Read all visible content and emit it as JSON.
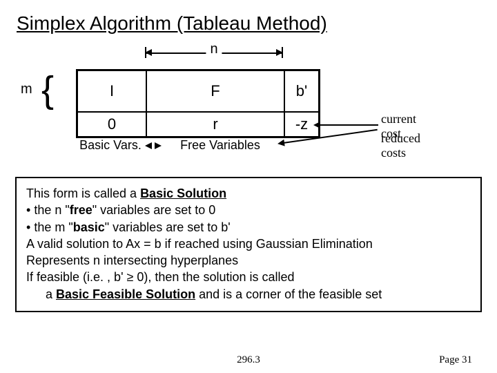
{
  "title": "Simplex Algorithm (Tableau Method)",
  "diagram": {
    "n_label": "n",
    "m_label": "m",
    "cells": {
      "I": "I",
      "F": "F",
      "bprime": "b'",
      "zero": "0",
      "r": "r",
      "negz": "-z"
    },
    "basic_vars_label": "Basic Vars.",
    "free_vars_label": "Free Variables",
    "current_cost_label": "current cost",
    "reduced_costs_label": "reduced costs"
  },
  "explain": {
    "line1_pre": "This form is called a ",
    "line1_bold": "Basic Solution",
    "bullet1_pre": "the n \"",
    "bullet1_bold": "free",
    "bullet1_post": "\" variables are set to 0",
    "bullet2_pre": "the m \"",
    "bullet2_bold": "basic",
    "bullet2_post": "\" variables are set to b'",
    "line4": "A valid solution to Ax = b if reached using Gaussian Elimination",
    "line5": "Represents n intersecting hyperplanes",
    "line6_pre": "If feasible (i.e. , b' ≥ 0), then the solution is called",
    "line7_pre": "a ",
    "line7_bold": "Basic Feasible Solution",
    "line7_post": " and is a corner of the feasible set"
  },
  "footer": {
    "course": "296.3",
    "page": "Page 31"
  }
}
